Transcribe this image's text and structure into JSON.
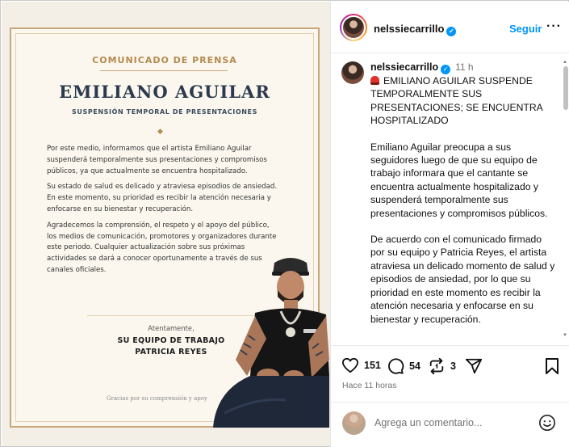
{
  "press": {
    "label": "COMUNICADO DE PRENSA",
    "name": "EMILIANO AGUILAR",
    "subtitle": "SUSPENSIÓN TEMPORAL DE PRESENTACIONES",
    "diamond": "◆",
    "paragraphs": [
      "Por este medio, informamos que el artista Emiliano Aguilar suspenderá temporalmente sus presentaciones y compromisos públicos, ya que actualmente se encuentra hospitalizado.",
      "Su estado de salud es delicado y atraviesa episodios de ansiedad. En este momento, su prioridad es recibir la atención necesaria y enfocarse en su bienestar y recuperación.",
      "Agradecemos la comprensión, el respeto y el apoyo del público, los medios de comunicación, promotores y organizadores durante este periodo. Cualquier actualización sobre sus próximas actividades se dará a conocer oportunamente a través de sus canales oficiales."
    ],
    "closing": "Atentamente,",
    "team": "SU EQUIPO DE TRABAJO",
    "signer": "PATRICIA REYES",
    "footer": "Gracias por su comprensión y apoy"
  },
  "header": {
    "username": "nelssiecarrillo",
    "follow_label": "Seguir",
    "more_label": "···"
  },
  "caption": {
    "username": "nelssiecarrillo",
    "time": "11 h",
    "headline": "EMILIANO AGUILAR SUSPENDE TEMPORALMENTE SUS PRESENTACIONES; SE ENCUENTRA HOSPITALIZADO",
    "paragraphs": [
      "Emiliano Aguilar preocupa a sus seguidores luego de que su equipo de trabajo informara que el cantante se encuentra actualmente hospitalizado y suspenderá temporalmente sus presentaciones y compromisos públicos.",
      "De acuerdo con el comunicado firmado por su equipo y Patricia Reyes, el artista atraviesa un delicado momento de salud y episodios de ansiedad, por lo que su prioridad en este momento es recibir la atención necesaria y enfocarse en su bienestar y recuperación."
    ]
  },
  "actions": {
    "likes": "151",
    "comments": "54",
    "reposts": "3",
    "posted_ago": "Hace 11 horas"
  },
  "comment_box": {
    "placeholder": "Agrega un comentario..."
  },
  "icons": [
    "verified-badge-icon",
    "siren-icon",
    "heart-icon",
    "comment-icon",
    "repost-icon",
    "share-icon",
    "bookmark-icon",
    "emoji-icon"
  ],
  "colors": {
    "link_blue": "#0095f6",
    "press_gold": "#b48a4f",
    "press_navy": "#2b3a4e"
  }
}
